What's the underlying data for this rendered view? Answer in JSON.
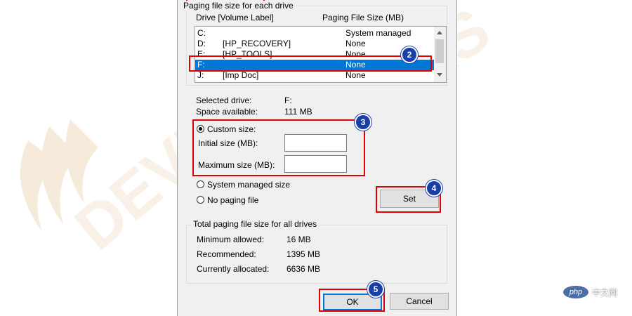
{
  "group_paging": {
    "title": "Paging file size for each drive",
    "col_drive": "Drive  [Volume Label]",
    "col_size": "Paging File Size (MB)"
  },
  "drives": [
    {
      "drive": "C:",
      "label": "",
      "size": "System managed"
    },
    {
      "drive": "D:",
      "label": "[HP_RECOVERY]",
      "size": "None"
    },
    {
      "drive": "E:",
      "label": "[HP_TOOLS]",
      "size": "None"
    },
    {
      "drive": "F:",
      "label": "",
      "size": "None",
      "selected": true
    },
    {
      "drive": "J:",
      "label": "[Imp Doc]",
      "size": "None"
    }
  ],
  "selected_drive": {
    "label": "Selected drive:",
    "value": "F:"
  },
  "space_available": {
    "label": "Space available:",
    "value": "111 MB"
  },
  "custom_size": {
    "label": "Custom size:",
    "checked": true
  },
  "initial_size": {
    "label": "Initial size (MB):",
    "value": ""
  },
  "maximum_size": {
    "label": "Maximum size (MB):",
    "value": ""
  },
  "system_managed": {
    "label": "System managed size",
    "checked": false
  },
  "no_paging": {
    "label": "No paging file",
    "checked": false
  },
  "set_button": "Set",
  "totals": {
    "title": "Total paging file size for all drives",
    "rows": [
      {
        "label": "Minimum allowed:",
        "value": "16 MB"
      },
      {
        "label": "Recommended:",
        "value": "1395 MB"
      },
      {
        "label": "Currently allocated:",
        "value": "6636 MB"
      }
    ]
  },
  "ok_button": "OK",
  "cancel_button": "Cancel",
  "steps": [
    "2",
    "3",
    "4",
    "5"
  ],
  "watermark_brand": {
    "php": "php",
    "cn": "中文网"
  },
  "colors": {
    "highlight": "#0078d7",
    "annotation_red": "#e00000",
    "step_badge": "#1a3ea8"
  }
}
